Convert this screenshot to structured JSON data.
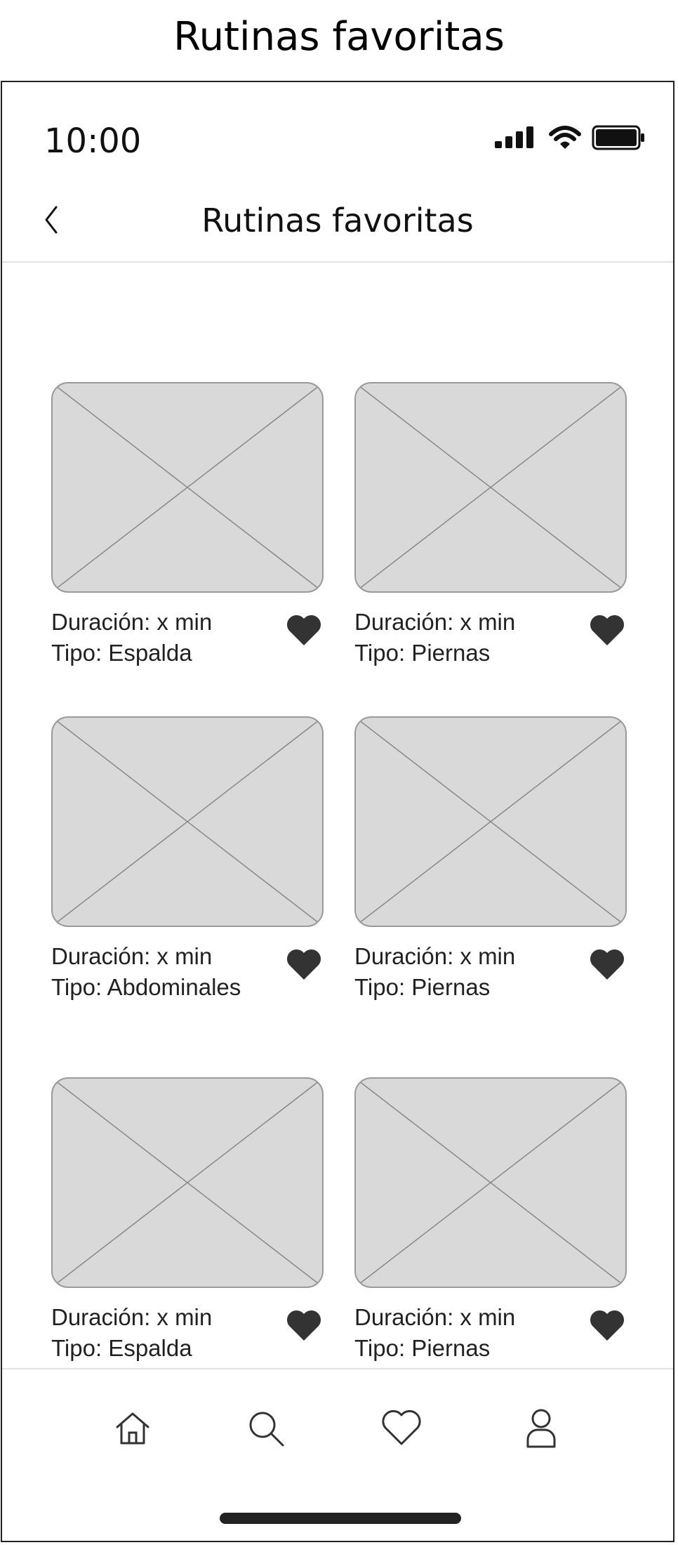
{
  "caption": "Rutinas favoritas",
  "status": {
    "time": "10:00"
  },
  "header": {
    "title": "Rutinas favoritas"
  },
  "routines": [
    {
      "duration": "Duración: x min",
      "type": "Tipo: Espalda"
    },
    {
      "duration": "Duración: x min",
      "type": "Tipo: Piernas"
    },
    {
      "duration": "Duración: x min",
      "type": "Tipo: Abdominales"
    },
    {
      "duration": "Duración: x min",
      "type": "Tipo: Piernas"
    },
    {
      "duration": "Duración: x min",
      "type": "Tipo: Espalda"
    },
    {
      "duration": "Duración: x min",
      "type": "Tipo: Piernas"
    }
  ],
  "icons": {
    "back": "chevron-left-icon",
    "favorite": "heart-filled-icon",
    "nav": [
      "home-icon",
      "search-icon",
      "heart-outline-icon",
      "user-icon"
    ]
  },
  "colors": {
    "placeholder": "#d9d9d9",
    "icon": "#333333",
    "divider": "#e2e2e2"
  }
}
